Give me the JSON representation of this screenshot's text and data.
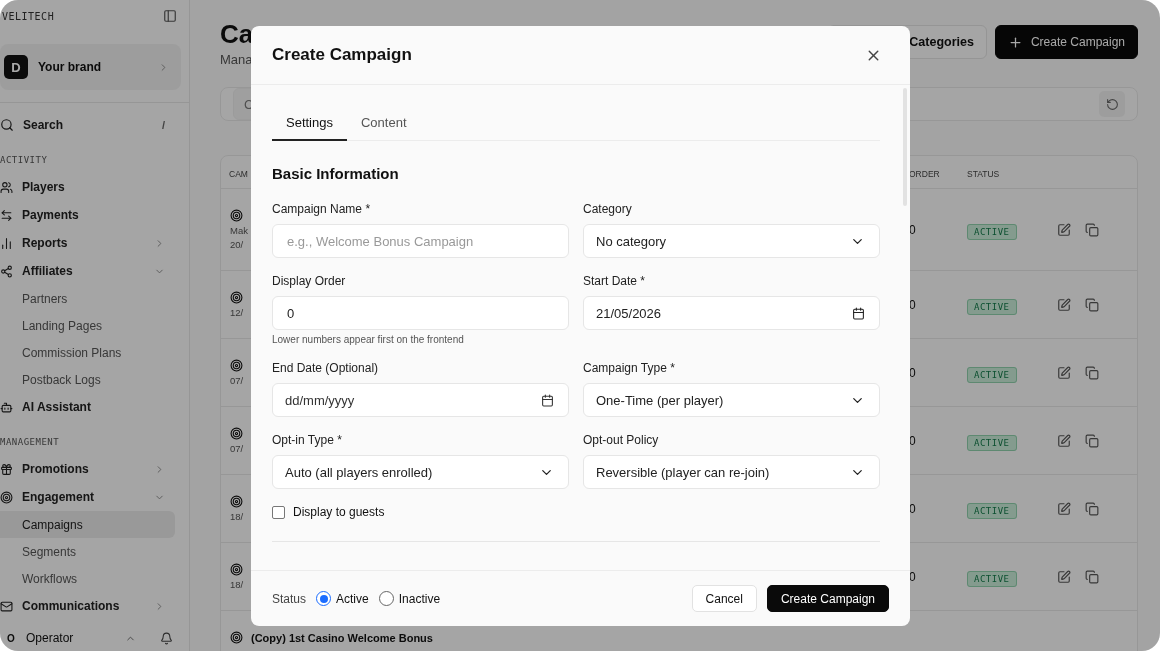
{
  "sidebar": {
    "brand": "VELITECH",
    "workspace": {
      "initial": "D",
      "name": "Your brand"
    },
    "search": {
      "label": "Search",
      "shortcut": "/"
    },
    "sections": [
      {
        "title": "ACTIVITY",
        "items": [
          {
            "label": "Players",
            "selected": false
          },
          {
            "label": "Payments",
            "selected": false
          },
          {
            "label": "Reports",
            "selected": false,
            "expanded": false
          },
          {
            "label": "Affiliates",
            "selected": false,
            "expanded": true,
            "children": [
              {
                "label": "Partners",
                "selected": false
              },
              {
                "label": "Landing Pages",
                "selected": false
              },
              {
                "label": "Commission Plans",
                "selected": false
              },
              {
                "label": "Postback Logs",
                "selected": false
              }
            ]
          },
          {
            "label": "AI Assistant",
            "selected": false
          }
        ]
      },
      {
        "title": "MANAGEMENT",
        "items": [
          {
            "label": "Promotions",
            "selected": false,
            "expanded": false
          },
          {
            "label": "Engagement",
            "selected": false,
            "expanded": true,
            "children": [
              {
                "label": "Campaigns",
                "selected": true
              },
              {
                "label": "Segments",
                "selected": false
              },
              {
                "label": "Workflows",
                "selected": false
              }
            ]
          },
          {
            "label": "Communications",
            "selected": false,
            "expanded": false
          }
        ]
      }
    ],
    "user": {
      "initial": "O",
      "name": "Operator"
    }
  },
  "page": {
    "title": "Ca",
    "subtitle": "Mana",
    "buttons": [
      {
        "label": "Categories",
        "kind": "secondary"
      },
      {
        "label": "Create Campaign",
        "kind": "primary"
      }
    ],
    "filter": {
      "placeholder": "C"
    }
  },
  "table": {
    "columns": [
      "CAM",
      "ORDER",
      "STATUS"
    ],
    "rows": [
      {
        "lines": [
          "Mak",
          "20/"
        ],
        "order": "0",
        "status": "ACTIVE"
      },
      {
        "lines": [
          "12/"
        ],
        "order": "0",
        "status": "ACTIVE"
      },
      {
        "lines": [
          "07/"
        ],
        "order": "0",
        "status": "ACTIVE"
      },
      {
        "lines": [
          "07/"
        ],
        "order": "0",
        "status": "ACTIVE"
      },
      {
        "lines": [
          "18/"
        ],
        "order": "0",
        "status": "ACTIVE"
      },
      {
        "lines": [
          "18/"
        ],
        "order": "0",
        "status": "ACTIVE"
      },
      {
        "name": "(Copy) 1st Casino Welcome Bonus"
      }
    ]
  },
  "modal": {
    "title": "Create Campaign",
    "tabs": [
      {
        "label": "Settings",
        "selected": true
      },
      {
        "label": "Content",
        "selected": false
      }
    ],
    "section": "Basic Information",
    "fields": [
      {
        "kind": "text",
        "label": "Campaign Name *",
        "placeholder": "e.g., Welcome Bonus Campaign"
      },
      {
        "kind": "select",
        "label": "Category",
        "value": "No category"
      },
      {
        "kind": "text",
        "label": "Display Order",
        "value": "0",
        "hint": "Lower numbers appear first on the frontend"
      },
      {
        "kind": "date",
        "label": "Start Date *",
        "value": "21/05/2026"
      },
      {
        "kind": "date",
        "label": "End Date (Optional)",
        "placeholder": "dd/mm/yyyy"
      },
      {
        "kind": "select",
        "label": "Campaign Type *",
        "value": "One-Time (per player)"
      },
      {
        "kind": "select",
        "label": "Opt-in Type *",
        "value": "Auto (all players enrolled)"
      },
      {
        "kind": "select",
        "label": "Opt-out Policy",
        "value": "Reversible (player can re-join)"
      }
    ],
    "guest_checkbox": {
      "label": "Display to guests",
      "checked": false
    },
    "status": {
      "label": "Status",
      "options": [
        {
          "label": "Active",
          "selected": true
        },
        {
          "label": "Inactive",
          "selected": false
        }
      ]
    },
    "buttons": [
      {
        "label": "Cancel",
        "kind": "secondary"
      },
      {
        "label": "Create Campaign",
        "kind": "primary"
      }
    ]
  }
}
